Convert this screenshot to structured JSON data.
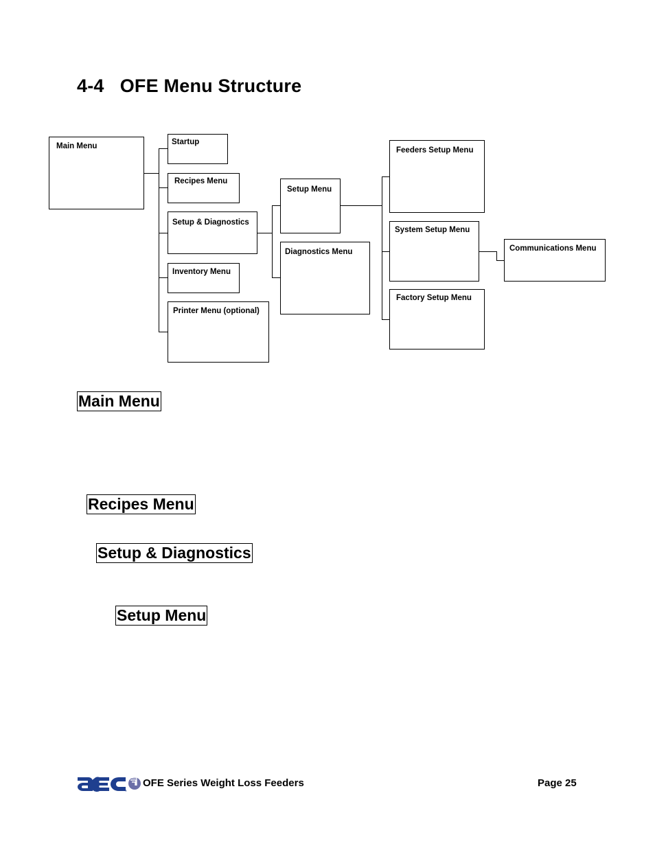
{
  "page": {
    "title": "4-4   OFE Menu Structure"
  },
  "diagram": {
    "nodes": {
      "main_menu": "Main Menu",
      "startup": "Startup",
      "recipes_menu": "Recipes Menu",
      "setup_diagnostics": "Setup & Diagnostics",
      "inventory_menu": "Inventory Menu",
      "printer_menu": "Printer Menu (optional)",
      "setup_menu": "Setup Menu",
      "diagnostics_menu": "Diagnostics Menu",
      "feeders_setup_menu": "Feeders Setup Menu",
      "system_setup_menu": "System Setup Menu",
      "factory_setup_menu": "Factory Setup Menu",
      "communications_menu": "Communications Menu"
    },
    "edges": [
      [
        "Main Menu",
        "Startup"
      ],
      [
        "Main Menu",
        "Recipes Menu"
      ],
      [
        "Main Menu",
        "Setup & Diagnostics"
      ],
      [
        "Main Menu",
        "Inventory Menu"
      ],
      [
        "Main Menu",
        "Printer Menu (optional)"
      ],
      [
        "Setup & Diagnostics",
        "Setup Menu"
      ],
      [
        "Setup & Diagnostics",
        "Diagnostics Menu"
      ],
      [
        "Setup Menu",
        "Feeders Setup Menu"
      ],
      [
        "Setup Menu",
        "System Setup Menu"
      ],
      [
        "Setup Menu",
        "Factory Setup Menu"
      ],
      [
        "System Setup Menu",
        "Communications Menu"
      ]
    ]
  },
  "sections": [
    "Main Menu",
    "Recipes Menu",
    "Setup & Diagnostics",
    "Setup Menu"
  ],
  "footer": {
    "logo_name": "AEC logo",
    "logo_colors": {
      "primary": "#1f3f8f",
      "accent": "#6b6fa8"
    },
    "product": "OFE Series Weight Loss Feeders",
    "page_number": "Page 25"
  }
}
